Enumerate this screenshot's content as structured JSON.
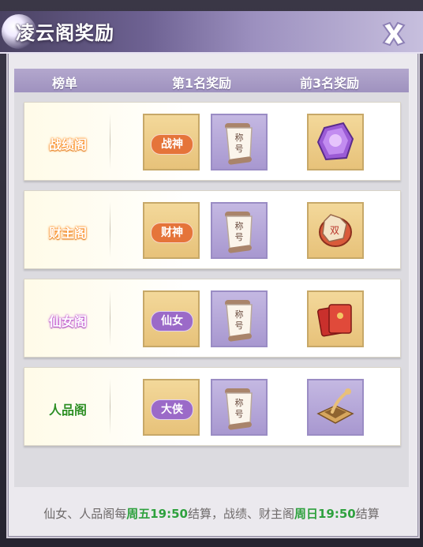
{
  "window": {
    "title": "凌云阁奖励",
    "close_icon": "close-x-icon"
  },
  "table": {
    "headers": [
      "榜单",
      "第1名奖励",
      "前3名奖励"
    ],
    "rows": [
      {
        "name": "战绩阁",
        "name_color": "#ff8a1c",
        "first_reward_tag": "战神",
        "tag_color": "#e5743a",
        "title_item": "称号",
        "top3_icon": "purple-crystal-icon"
      },
      {
        "name": "财主阁",
        "name_color": "#ff8a1c",
        "first_reward_tag": "财神",
        "tag_color": "#e5743a",
        "title_item": "称号",
        "top3_icon": "lucky-fish-coin-icon"
      },
      {
        "name": "仙女阁",
        "name_color": "#c45ad6",
        "first_reward_tag": "仙女",
        "tag_color": "#9b6ac8",
        "title_item": "称号",
        "top3_icon": "red-envelope-icon"
      },
      {
        "name": "人品阁",
        "name_color": "#42a832",
        "first_reward_tag": "大侠",
        "tag_color": "#9b6ac8",
        "title_item": "称号",
        "top3_icon": "mortar-spoon-icon"
      }
    ]
  },
  "footer": {
    "part1": "仙女、人品阁每",
    "time1": "周五19:50",
    "part2": "结算，战绩、财主阁",
    "time2": "周日19:50",
    "part3": "结算"
  }
}
